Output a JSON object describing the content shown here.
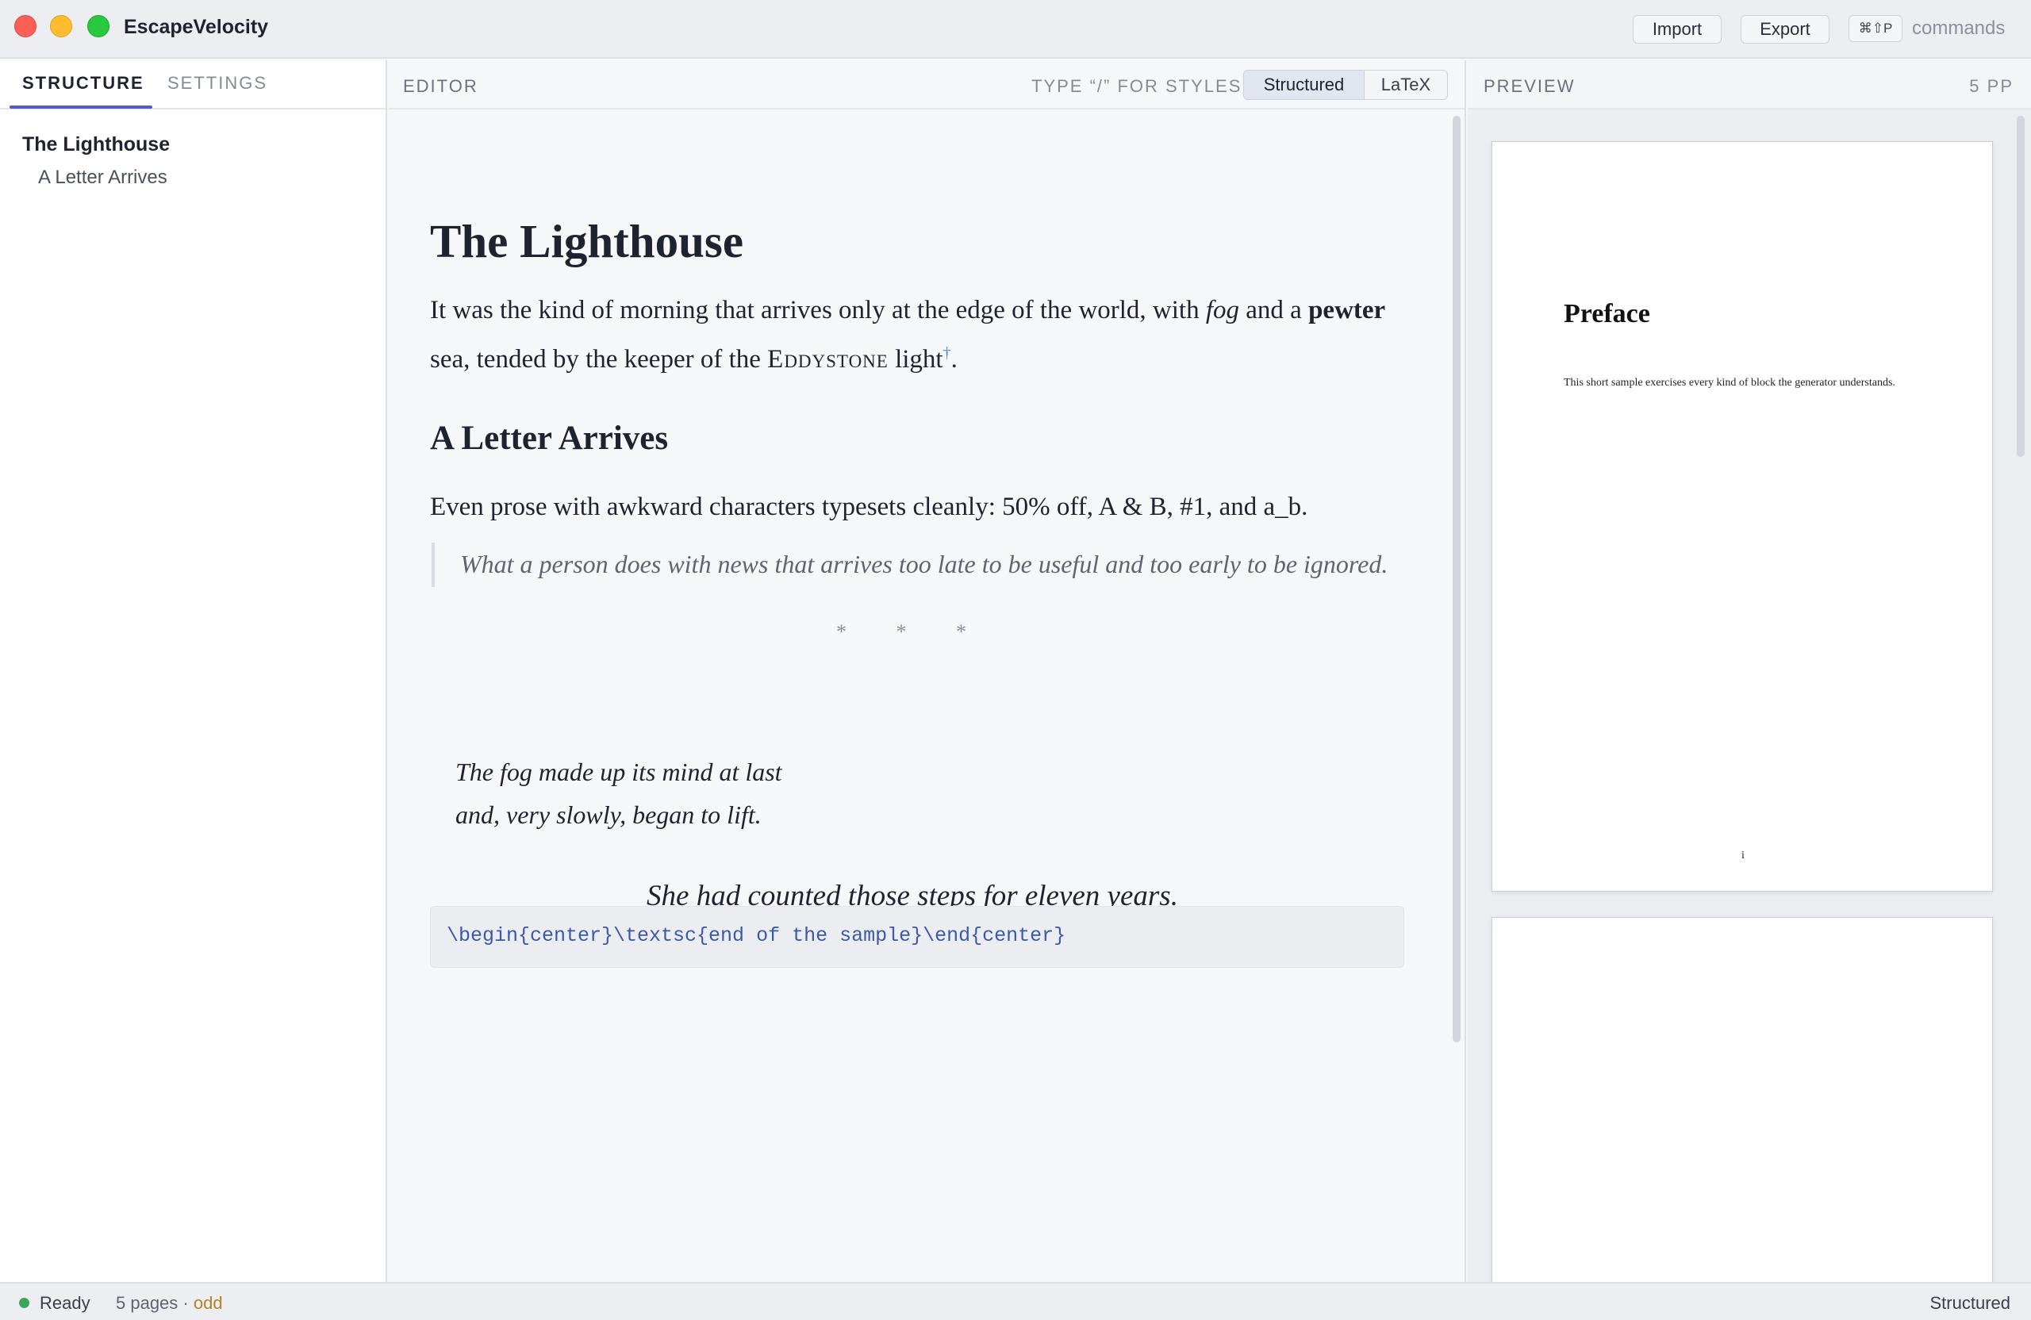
{
  "app": {
    "title": "EscapeVelocity"
  },
  "titlebar": {
    "import_label": "Import",
    "export_label": "Export",
    "shortcut": "⌘⇧P",
    "commands_label": "commands"
  },
  "sidebar": {
    "tabs": [
      {
        "label": "STRUCTURE",
        "active": true
      },
      {
        "label": "SETTINGS",
        "active": false
      }
    ],
    "outline": [
      {
        "label": "The Lighthouse",
        "level": 1
      },
      {
        "label": "A Letter Arrives",
        "level": 2
      }
    ]
  },
  "editor": {
    "title": "EDITOR",
    "hint": "TYPE “/” FOR STYLES",
    "modes": [
      "Structured",
      "LaTeX"
    ],
    "active_mode": "Structured",
    "content": {
      "heading1": "The Lighthouse",
      "para1_a": "It was the kind of morning that arrives only at the edge of the world, with ",
      "para1_fog": "fog",
      "para1_b": " and a ",
      "para1_pewter": "pewter",
      "para1_c": " sea, tended by the keeper of the ",
      "para1_sc": "Eddystone",
      "para1_d": " light",
      "para1_fn": "†",
      "para1_e": ".",
      "heading2": "A Letter Arrives",
      "para2": "Even prose with awkward characters typesets cleanly: 50% off, A & B, #1, and a_b.",
      "quote": "What a person does with news that arrives too late to be useful and too early to be ignored.",
      "break": "* * *",
      "verse_1": "The fog made up its mind at last",
      "verse_2": "and, very slowly, began to lift.",
      "center": "She had counted those steps for eleven years.",
      "code": "\\begin{center}\\textsc{end of the sample}\\end{center}"
    }
  },
  "preview": {
    "title": "PREVIEW",
    "pages_label": "5 PP",
    "page1": {
      "heading": "Preface",
      "text": "This short sample exercises every kind of block the generator understands.",
      "number": "i"
    }
  },
  "status": {
    "ready": "Ready",
    "pages": "5 pages · ",
    "parity": "odd",
    "mode": "Structured"
  },
  "colors": {
    "accent": "#4a5bd4",
    "status_ok": "#3aa757",
    "code_text": "#3b59a8"
  }
}
